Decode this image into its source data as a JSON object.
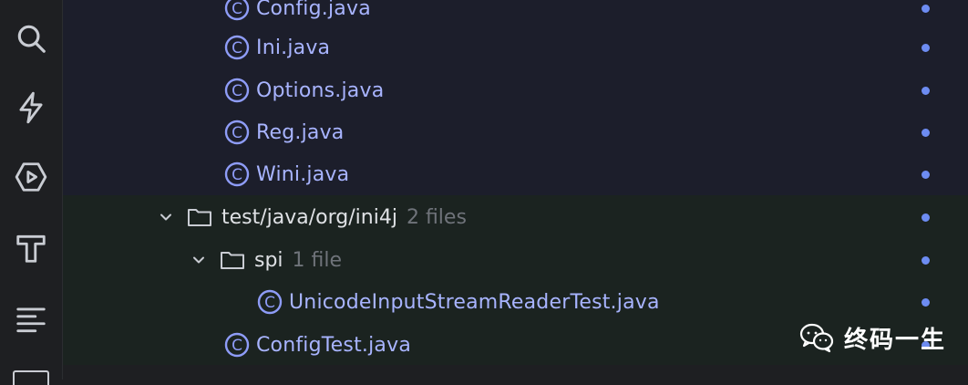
{
  "toolbar": {
    "tools": [
      {
        "icon": "search-icon"
      },
      {
        "icon": "lightning-icon"
      },
      {
        "icon": "run-hexagon-icon"
      },
      {
        "icon": "hammer-icon"
      },
      {
        "icon": "align-left-icon"
      }
    ]
  },
  "tree": {
    "rows": [
      {
        "type": "class",
        "label": "Config.java"
      },
      {
        "type": "class",
        "label": "Ini.java"
      },
      {
        "type": "class",
        "label": "Options.java"
      },
      {
        "type": "class",
        "label": "Reg.java"
      },
      {
        "type": "class",
        "label": "Wini.java"
      },
      {
        "type": "folder",
        "label": "test/java/org/ini4j",
        "count": "2 files",
        "expanded": true
      },
      {
        "type": "folder",
        "label": "spi",
        "count": "1 file",
        "expanded": true
      },
      {
        "type": "class",
        "label": "UnicodeInputStreamReaderTest.java"
      },
      {
        "type": "class",
        "label": "ConfigTest.java"
      }
    ]
  },
  "colors": {
    "class_name": "#a8b4ff",
    "modified_dot": "#6d8cf2",
    "changed_bg": "#1b2320"
  },
  "watermark": {
    "text": "终码一生"
  }
}
